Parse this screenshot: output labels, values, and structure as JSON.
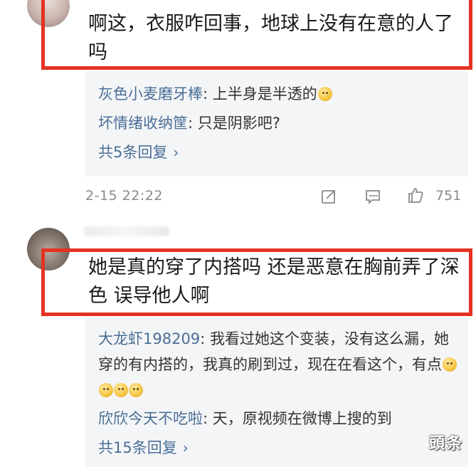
{
  "comment1": {
    "text": "啊这，衣服咋回事，地球上没有在意的人了吗",
    "replies": [
      {
        "user": "灰色小麦磨牙棒",
        "text": "上半身是半透的",
        "emoji": "smile-emoji"
      },
      {
        "user": "坏情绪收纳筐",
        "text": "只是阴影吧?"
      }
    ],
    "more_replies": "共5条回复",
    "timestamp": "2-15 22:22",
    "like_count": "751"
  },
  "comment2": {
    "text": "她是真的穿了内搭吗 还是恶意在胸前弄了深色 误导他人啊",
    "replies": [
      {
        "user": "大龙虾198209",
        "text": "我看过她这个变装，没有这么漏，她穿的有内搭的，我真的刷到过，现在在看这个，有点",
        "emoji_count": 4
      },
      {
        "user": "欣欣今天不吃啦",
        "text": "天，原视频在微博上搜的到"
      }
    ],
    "more_replies": "共15条回复"
  },
  "watermark": "頭条",
  "colors": {
    "highlight_border": "#e43222",
    "username": "#4a6f96",
    "reply_bg": "#f4f5f7",
    "meta_text": "#8a8a8a"
  },
  "icons": [
    "avatar",
    "share-icon",
    "comment-icon",
    "like-icon",
    "chevron-right-icon"
  ]
}
